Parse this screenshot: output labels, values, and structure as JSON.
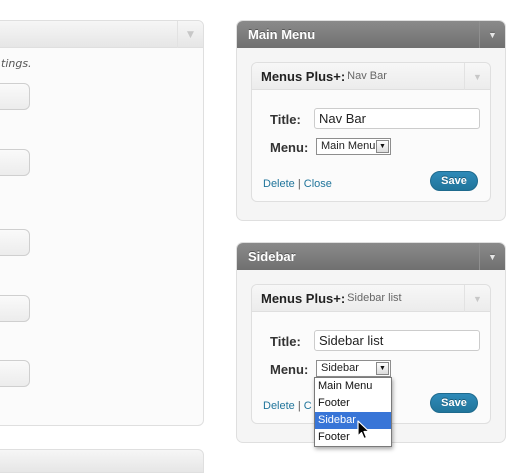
{
  "left_panel": {
    "description_fragment": "tings."
  },
  "main_menu_area": {
    "title": "Main Menu",
    "widget": {
      "name": "Menus Plus+:",
      "subtitle": "Nav Bar",
      "title_label": "Title:",
      "title_value": "Nav Bar",
      "menu_label": "Menu:",
      "menu_selected": "Main Menu",
      "delete_link": "Delete",
      "separator": "|",
      "close_link": "Close",
      "save_label": "Save"
    }
  },
  "sidebar_area": {
    "title": "Sidebar",
    "widget": {
      "name": "Menus Plus+:",
      "subtitle": "Sidebar list",
      "title_label": "Title:",
      "title_value": "Sidebar list",
      "menu_label": "Menu:",
      "menu_selected": "Sidebar",
      "delete_link": "Delete",
      "separator": "|",
      "close_link": "C",
      "save_label": "Save"
    }
  },
  "dropdown": {
    "options": [
      "Main Menu",
      "Footer",
      "Sidebar",
      "Footer"
    ],
    "highlighted": "Sidebar"
  },
  "colors": {
    "accent": "#21759b",
    "highlight": "#3875d7",
    "area_header": "#7a7a7a"
  },
  "icons": {
    "toggle": "triangle-down",
    "cursor": "arrow-pointer"
  }
}
